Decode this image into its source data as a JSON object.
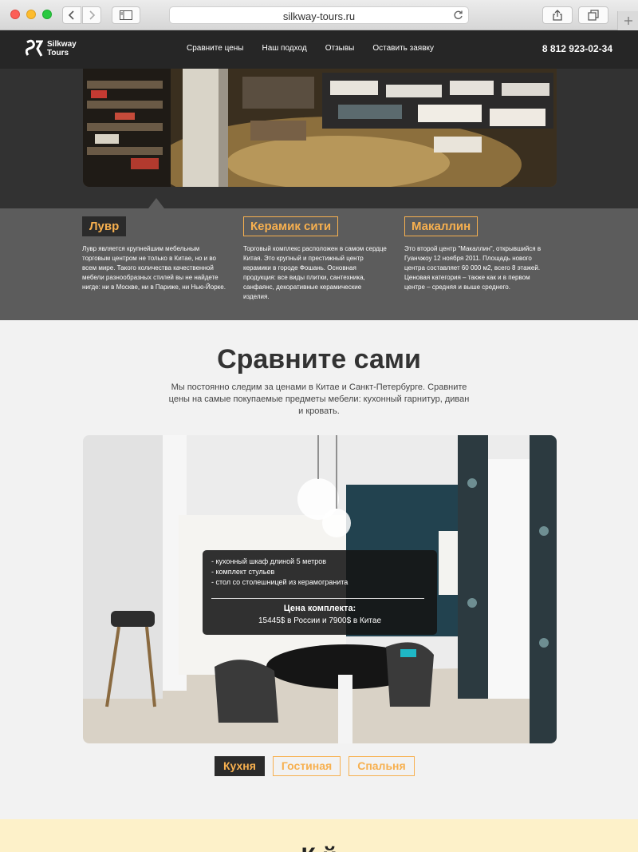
{
  "browser": {
    "url": "silkway-tours.ru"
  },
  "site": {
    "logo_line1": "Silkway",
    "logo_line2": "Tours",
    "nav": [
      {
        "label": "Сравните цены"
      },
      {
        "label": "Наш подход"
      },
      {
        "label": "Отзывы"
      },
      {
        "label": "Оставить заявку"
      }
    ],
    "phone": "8 812 923-02-34"
  },
  "malls": [
    {
      "name": "Лувр",
      "active": true,
      "text": "Лувр является крупнейшим мебельным торговым центром не только в Китае, но и во всем мире. Такого количества качественной мебели разнообразных стилей вы не найдете нигде: ни в Москве, ни в Париже, ни Нью-Йорке."
    },
    {
      "name": "Керамик сити",
      "active": false,
      "text": "Торговый комплекс расположен в самом сердце Китая. Это крупный и престижный центр керамики в городе Фошань. Основная продукция: все виды плитки, сантехника, санфаянс, декоративные керамические изделия."
    },
    {
      "name": "Макаллин",
      "active": false,
      "text": "Это второй центр \"Макаллин\", открывшийся в Гуанчжоу 12 ноября 2011. Площадь нового центра составляет 60 000 м2, всего 8 этажей. Ценовая категория – также как и в первом центре – средняя и выше среднего."
    }
  ],
  "compare": {
    "title": "Сравните сами",
    "subtitle": "Мы постоянно следим за ценами в Китае и Санкт-Петербурге. Сравните цены на самые покупаемые предметы мебели: кухонный гарнитур, диван и кровать.",
    "items": [
      "- кухонный шкаф длиной 5 метров",
      "- комплект стульев",
      "- стол со столешницей из керамогранита"
    ],
    "price_label": "Цена комплекта:",
    "price_value": "15445$ в России и 7900$ в Китае",
    "tabs": [
      {
        "label": "Кухня",
        "active": true
      },
      {
        "label": "Гостиная",
        "active": false
      },
      {
        "label": "Спальня",
        "active": false
      }
    ]
  },
  "next_section": {
    "title_partial": "К          й    "
  },
  "colors": {
    "accent": "#f7b04f",
    "dark": "#262626",
    "band": "#5c5c5c"
  }
}
